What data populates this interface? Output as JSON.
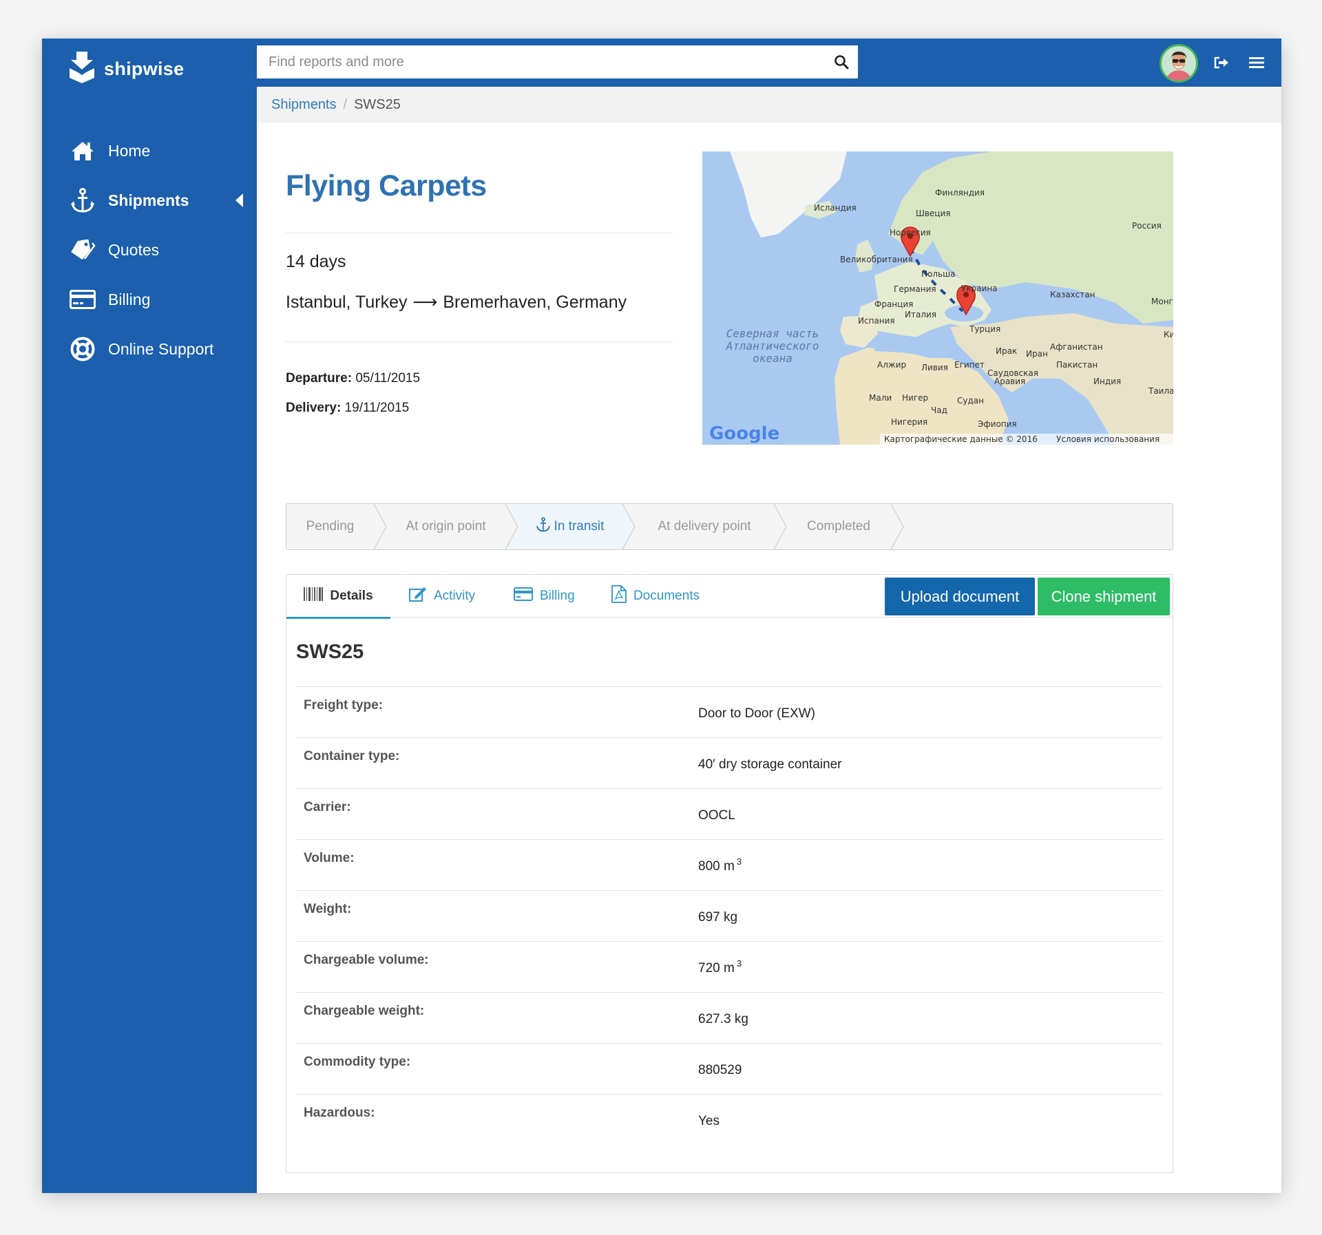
{
  "app": {
    "name": "shipwise"
  },
  "sidebar": {
    "items": [
      {
        "label": "Home",
        "icon": "home-icon"
      },
      {
        "label": "Shipments",
        "icon": "anchor-icon",
        "active": true
      },
      {
        "label": "Quotes",
        "icon": "tag-icon"
      },
      {
        "label": "Billing",
        "icon": "credit-card-icon"
      },
      {
        "label": "Online Support",
        "icon": "lifebuoy-icon"
      }
    ]
  },
  "topbar": {
    "search_placeholder": "Find reports and more",
    "icons": [
      "search-icon",
      "avatar",
      "logout-icon",
      "menu-icon"
    ]
  },
  "breadcrumb": {
    "parent": "Shipments",
    "separator": "/",
    "current": "SWS25"
  },
  "shipment": {
    "title": "Flying Carpets",
    "duration": "14 days",
    "origin": "Istanbul, Turkey",
    "arrow": "⟶",
    "destination": "Bremerhaven, Germany",
    "departure_label": "Departure:",
    "departure": "05/11/2015",
    "delivery_label": "Delivery:",
    "delivery": "19/11/2015"
  },
  "map": {
    "labels": {
      "finland": "Финляндия",
      "iceland": "Исландия",
      "sweden": "Швеция",
      "russia": "Россия",
      "norway": "Норвегия",
      "uk": "Великобритания",
      "poland": "Польша",
      "germany": "Германия",
      "ukraine": "Украина",
      "kazakhstan": "Казахстан",
      "mongolia": "Монг",
      "france": "Франция",
      "spain": "Испания",
      "italy": "Италия",
      "turkey": "Турция",
      "ocean_1": "Северная часть",
      "ocean_2": "Атлантического",
      "ocean_3": "океана",
      "iraq": "Ирак",
      "iran": "Иран",
      "afghanistan": "Афганистан",
      "algeria": "Алжир",
      "libya": "Ливия",
      "egypt": "Египет",
      "pakistan": "Пакистан",
      "saudi_1": "Саудовская",
      "saudi_2": "Аравия",
      "india": "Индия",
      "china": "Ки",
      "thailand": "Таила",
      "mali": "Мали",
      "niger": "Нигер",
      "sudan": "Судан",
      "chad": "Чад",
      "nigeria": "Нигерия",
      "ethiopia": "Эфиопия"
    },
    "brand": "Google",
    "copyright": "Картографические данные © 2016",
    "terms": "Условия использования"
  },
  "steps": [
    {
      "label": "Pending"
    },
    {
      "label": "At origin point"
    },
    {
      "label": "In transit",
      "active": true,
      "icon": "anchor-icon"
    },
    {
      "label": "At delivery point"
    },
    {
      "label": "Completed"
    }
  ],
  "tabs": [
    {
      "label": "Details",
      "icon": "barcode-icon",
      "active": true
    },
    {
      "label": "Activity",
      "icon": "edit-icon"
    },
    {
      "label": "Billing",
      "icon": "credit-card-icon"
    },
    {
      "label": "Documents",
      "icon": "pdf-icon"
    }
  ],
  "actions": {
    "upload": "Upload document",
    "clone": "Clone shipment"
  },
  "details": {
    "heading": "SWS25",
    "rows": [
      {
        "label": "Freight type:",
        "value": "Door to Door (EXW)"
      },
      {
        "label": "Container type:",
        "value": "40′ dry storage container"
      },
      {
        "label": "Carrier:",
        "value": "OOCL"
      },
      {
        "label": "Volume:",
        "value": "800 m",
        "sup": "3"
      },
      {
        "label": "Weight:",
        "value": "697 kg"
      },
      {
        "label": "Chargeable volume:",
        "value": "720 m",
        "sup": "3"
      },
      {
        "label": "Chargeable weight:",
        "value": "627.3 kg"
      },
      {
        "label": "Commodity type:",
        "value": "880529"
      },
      {
        "label": "Hazardous:",
        "value": "Yes"
      }
    ]
  },
  "colors": {
    "primary": "#1b5fad",
    "link": "#2f7bb8",
    "tab": "#2f97c9",
    "upload": "#1567ac",
    "clone": "#2ebd66"
  }
}
